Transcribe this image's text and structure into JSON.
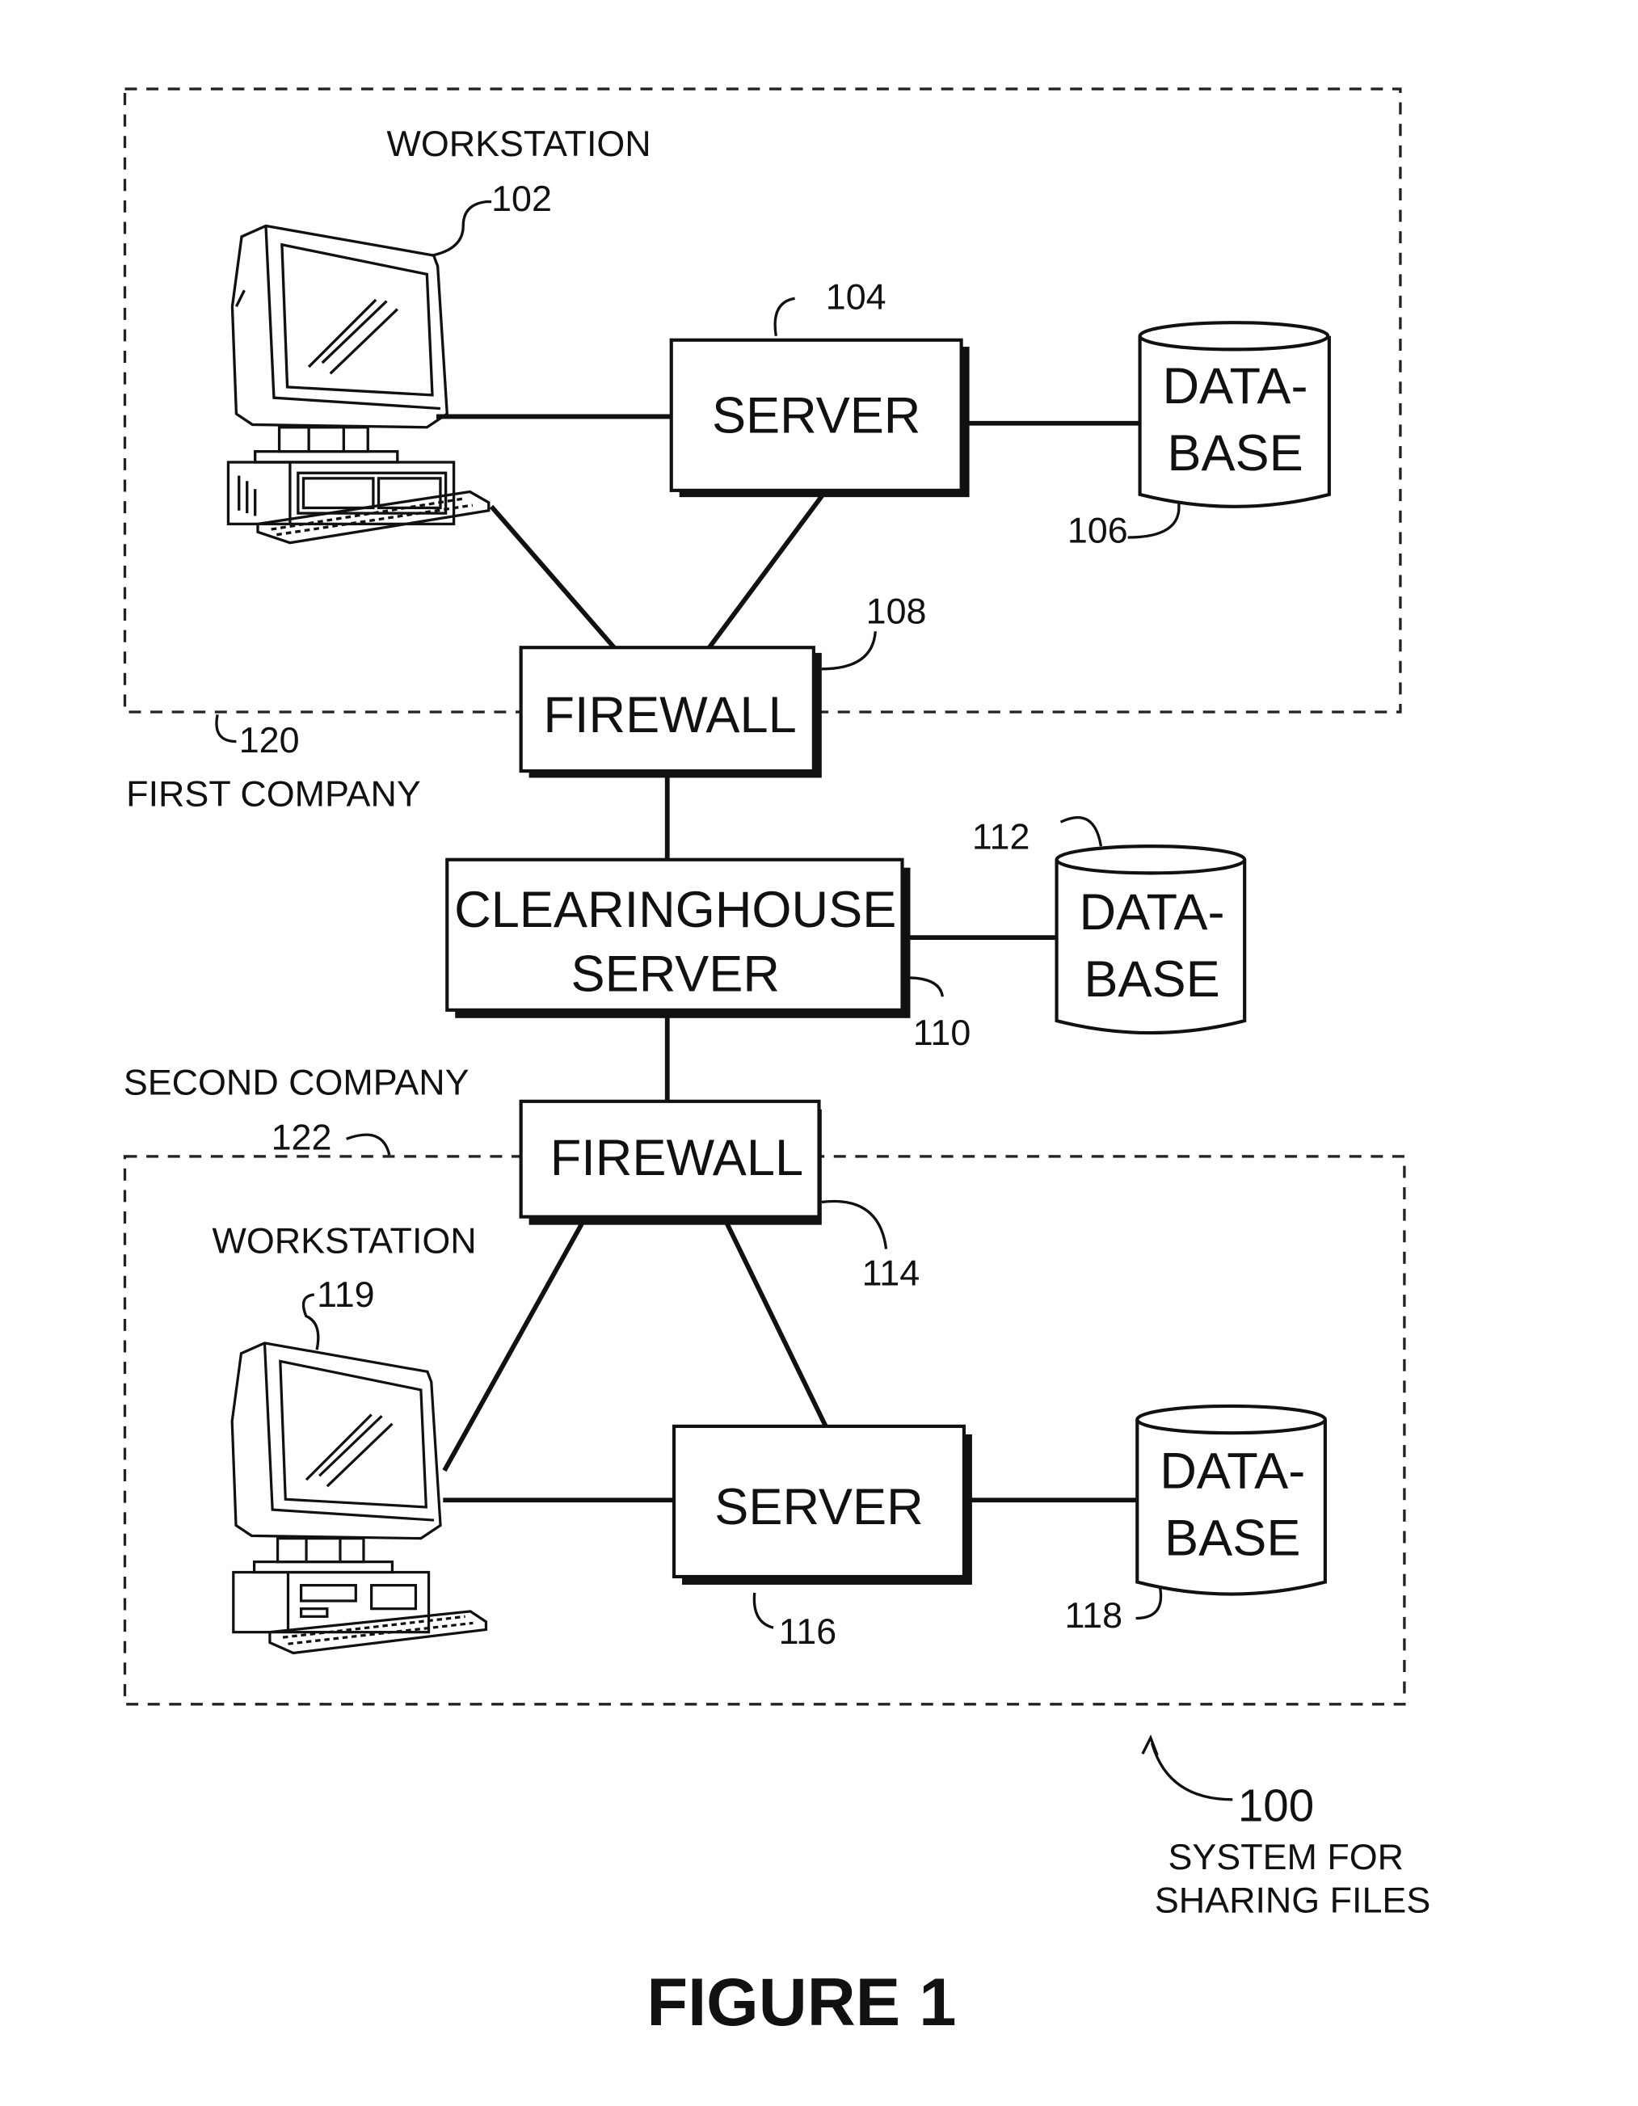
{
  "figure": {
    "title": "FIGURE 1",
    "system_ref": "100",
    "system_label_lines": [
      "SYSTEM FOR",
      "SHARING FILES"
    ]
  },
  "first_company": {
    "label": "FIRST COMPANY",
    "ref": "120",
    "workstation": {
      "label": "WORKSTATION",
      "ref": "102"
    },
    "server": {
      "label": "SERVER",
      "ref": "104"
    },
    "database": {
      "label_lines": [
        "DATA-",
        "BASE"
      ],
      "ref": "106"
    },
    "firewall": {
      "label": "FIREWALL",
      "ref": "108"
    }
  },
  "clearinghouse": {
    "server": {
      "label_lines": [
        "CLEARINGHOUSE",
        "SERVER"
      ],
      "ref": "110"
    },
    "database": {
      "label_lines": [
        "DATA-",
        "BASE"
      ],
      "ref": "112"
    }
  },
  "second_company": {
    "label": "SECOND COMPANY",
    "ref": "122",
    "firewall": {
      "label": "FIREWALL",
      "ref": "114"
    },
    "workstation": {
      "label": "WORKSTATION",
      "ref": "119"
    },
    "server": {
      "label": "SERVER",
      "ref": "116"
    },
    "database": {
      "label_lines": [
        "DATA-",
        "BASE"
      ],
      "ref": "118"
    }
  }
}
